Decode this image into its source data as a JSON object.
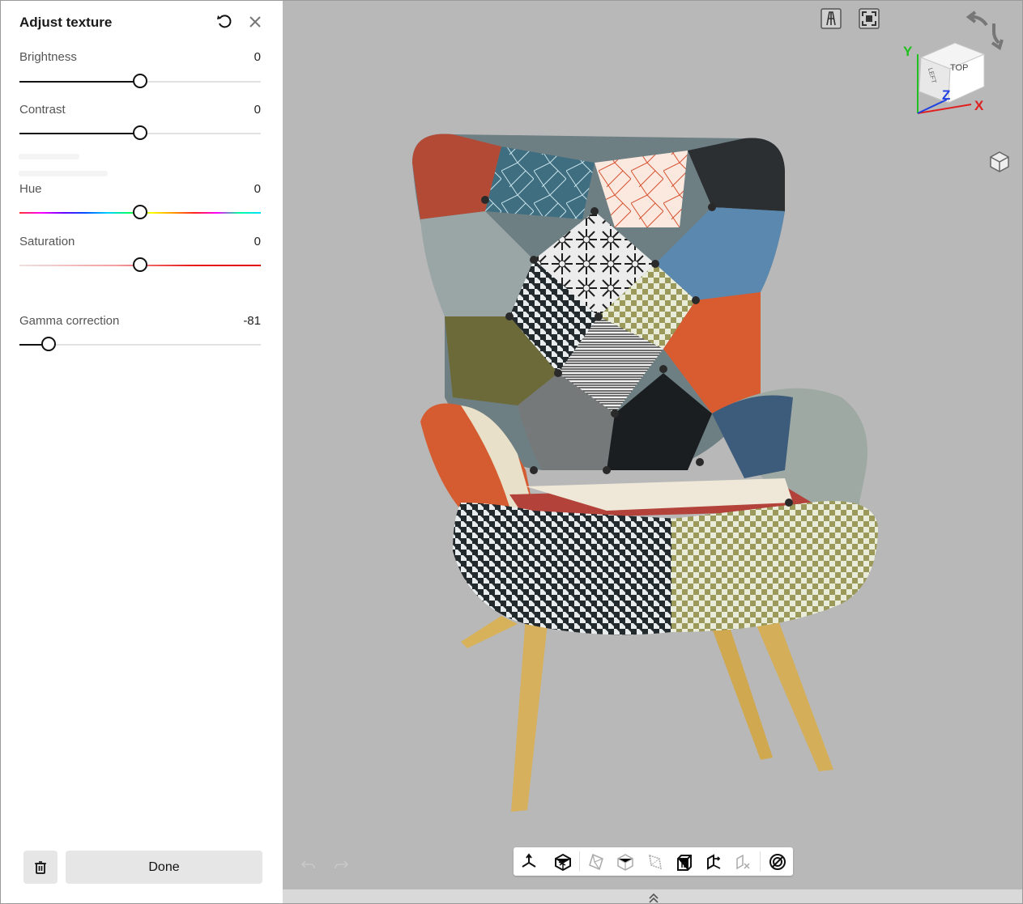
{
  "panel": {
    "title": "Adjust texture",
    "reset_icon": "reset-icon",
    "close_icon": "close-icon",
    "sliders": [
      {
        "label": "Brightness",
        "value": "0",
        "position": 0.5
      },
      {
        "label": "Contrast",
        "value": "0",
        "position": 0.5
      },
      {
        "label": "Hue",
        "value": "0",
        "position": 0.5
      },
      {
        "label": "Saturation",
        "value": "0",
        "position": 0.5
      },
      {
        "label": "Gamma correction",
        "value": "-81",
        "position": 0.12
      }
    ],
    "delete_icon": "trash-icon",
    "done_label": "Done"
  },
  "viewport": {
    "background": "#b8b8b8",
    "view_cube": {
      "top_label": "TOP",
      "left_label": "LEFT",
      "axes": {
        "x": "X",
        "y": "Y",
        "z": "Z"
      }
    },
    "axis_colors": {
      "x": "#e02020",
      "y": "#20c020",
      "z": "#2040e0"
    },
    "top_icons": [
      "perspective-icon",
      "fit-view-icon"
    ],
    "side_icon": "cube-view-icon",
    "toolbar_icons": [
      "axes-icon",
      "textured-box-icon",
      "solid-icon",
      "shaded-icon",
      "wireframe-icon",
      "box-icon",
      "section-icon",
      "clear-section-icon",
      "texture-rings-icon"
    ],
    "undo_icon": "undo-icon",
    "redo_icon": "redo-icon",
    "expand_icon": "double-chevron-up-icon"
  }
}
